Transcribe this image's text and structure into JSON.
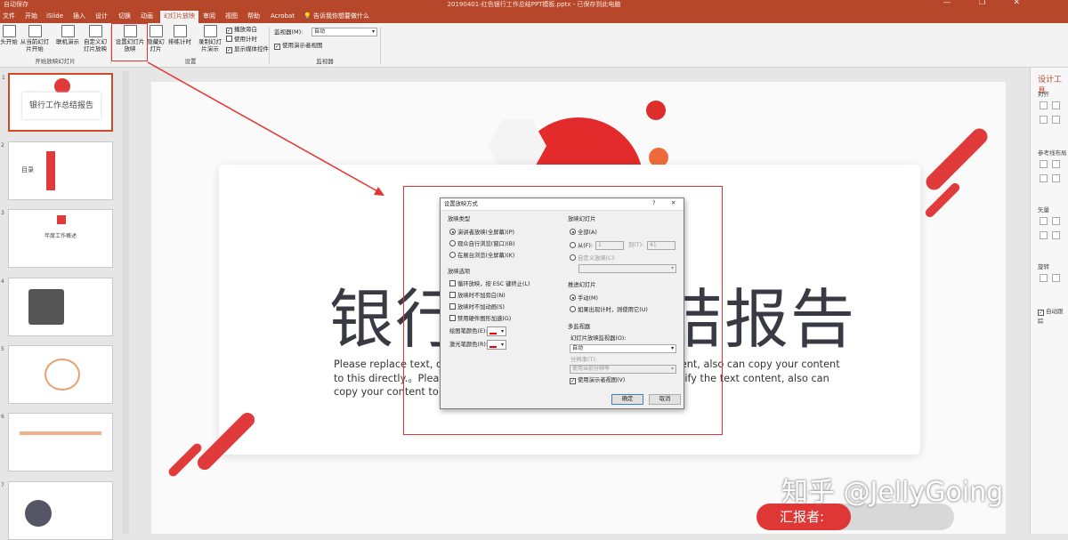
{
  "titlebar": {
    "left": "自动保存",
    "file": "20190401-红色银行工作总结PPT模板.pptx - 已保存到此电脑"
  },
  "tabs": [
    "文件",
    "开始",
    "iSlide",
    "插入",
    "设计",
    "切换",
    "动画",
    "幻灯片放映",
    "审阅",
    "视图",
    "帮助",
    "Acrobat"
  ],
  "tellme": "告诉我你想要做什么",
  "ribbon": {
    "from_start": "头开始",
    "from_current": "从当前幻灯片开始",
    "online": "联机演示",
    "custom": "自定义幻灯片放映",
    "group_start": "开始放映幻灯片",
    "setup": "设置幻灯片放映",
    "hide": "隐藏幻灯片",
    "rehearse": "排练计时",
    "record": "录制幻灯片演示",
    "play_narration": "播放旁白",
    "use_timing": "使用计时",
    "show_media": "显示媒体控件",
    "group_setup": "设置",
    "monitor_label": "监视器(M):",
    "monitor_value": "自动",
    "presenter_view": "使用演示者视图",
    "group_monitor": "监视器"
  },
  "slides": [
    {
      "num": "1",
      "title": "银行工作总结报告"
    },
    {
      "num": "2",
      "title": "目录"
    },
    {
      "num": "3",
      "title": "年度工作概述"
    },
    {
      "num": "4",
      "title": ""
    },
    {
      "num": "5",
      "title": ""
    },
    {
      "num": "6",
      "title": ""
    },
    {
      "num": "7",
      "title": ""
    }
  ],
  "slide": {
    "title": "银行工作总结报告",
    "paragraph": "Please replace text, click add relevant headline, modify the text content, also can copy your content to this directly.。Please replace text, click add relevant headline, modify the text content, also can copy your content to this directly.。",
    "reporter": "汇报者:",
    "watermark": "知乎 @JellyGoing"
  },
  "right_pane": {
    "title": "设计工具",
    "align": "对齐",
    "ref": "参考线布局",
    "vector": "矢量",
    "rotate": "旋转",
    "auto": "自动跟踪"
  },
  "dialog": {
    "title": "设置放映方式",
    "help": "?",
    "close": "✕",
    "type_title": "放映类型",
    "type_options": [
      "演讲者放映(全屏幕)(P)",
      "观众自行浏览(窗口)(B)",
      "在展台浏览(全屏幕)(K)"
    ],
    "type_selected": 0,
    "opts_title": "放映选项",
    "opts": [
      "循环放映，按 ESC 键终止(L)",
      "放映时不加旁白(N)",
      "放映时不加动画(S)",
      "禁用硬件图形加速(G)"
    ],
    "pen_color": "绘图笔颜色(E):",
    "laser_color": "激光笔颜色(R):",
    "slides_title": "放映幻灯片",
    "all": "全部(A)",
    "from": "从(F):",
    "from_val": "1",
    "to": "到(T):",
    "to_val": "41",
    "custom_show": "自定义放映(C):",
    "advance_title": "推进幻灯片",
    "manual": "手动(M)",
    "timing": "如果出现计时，则使用它(U)",
    "monitors_title": "多监视器",
    "monitor_label": "幻灯片放映监视器(O):",
    "monitor_value": "自动",
    "resolution_label": "分辨率(T):",
    "resolution_value": "使用当前分辨率",
    "presenter_view": "使用演示者视图(V)",
    "ok": "确定",
    "cancel": "取消"
  },
  "colors": {
    "accent": "#b7472a",
    "red": "#e03a3a"
  }
}
